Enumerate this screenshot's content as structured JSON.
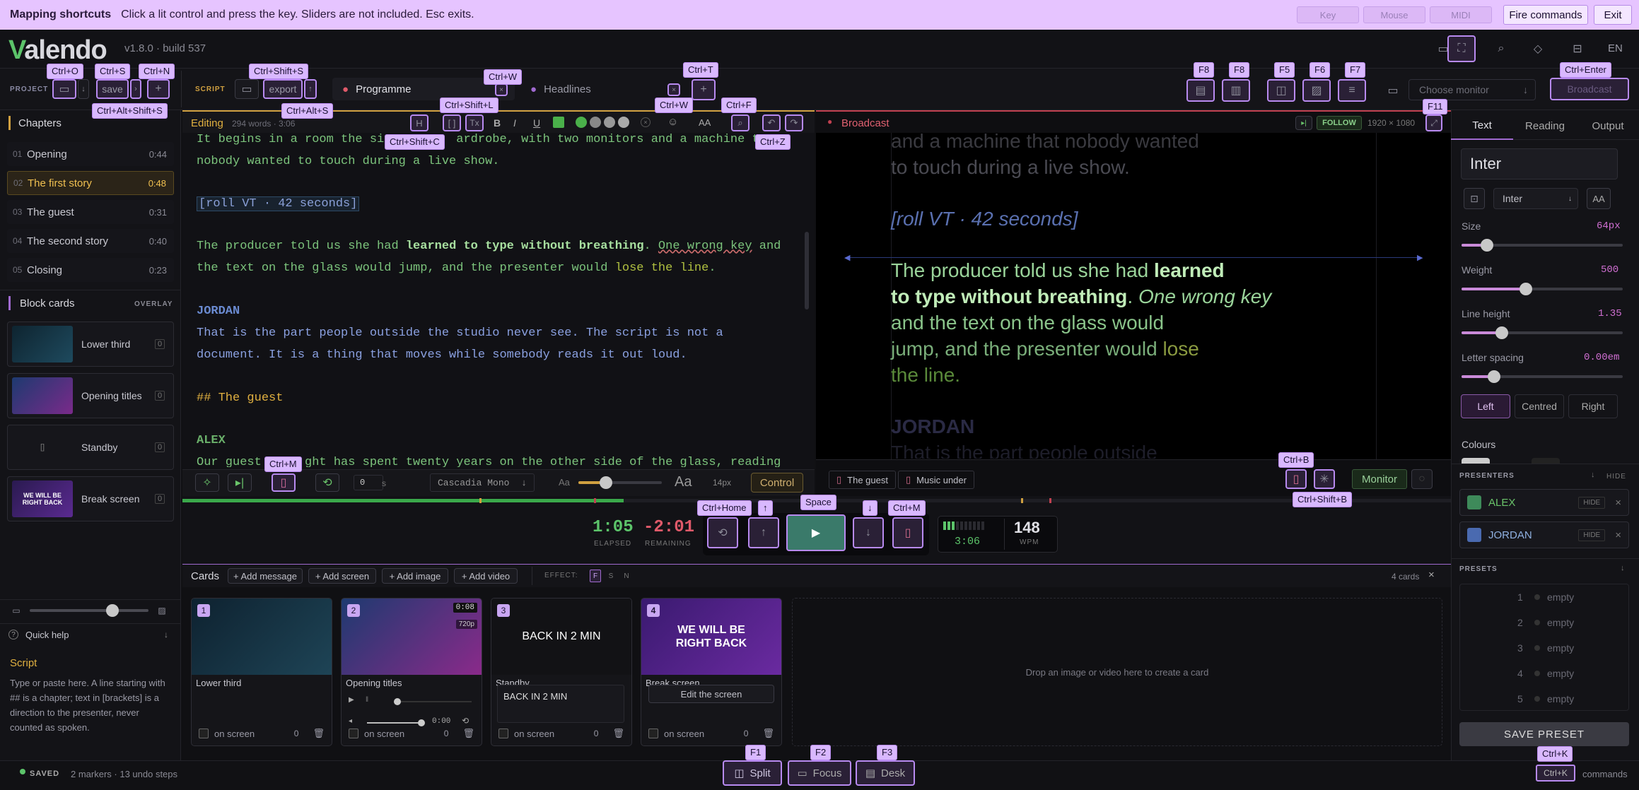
{
  "mapping": {
    "title": "Mapping shortcuts",
    "hint": "Click a lit control and press the key. Sliders are not included. Esc exits.",
    "key": "Key",
    "mouse": "Mouse",
    "midi": "MIDI",
    "fire": "Fire commands",
    "exit": "Exit"
  },
  "app": {
    "logo": "Valendo",
    "version": "v1.8.0 · build 537",
    "lang": "EN"
  },
  "toolbar": {
    "project": "PROJECT",
    "script": "SCRIPT",
    "save": "save",
    "export": "export",
    "tab1": "Programme",
    "tab2": "Headlines",
    "monitor_placeholder": "Choose monitor",
    "broadcast": "Broadcast"
  },
  "shortcuts": {
    "open": "Ctrl+O",
    "save": "Ctrl+S",
    "new": "Ctrl+N",
    "saveas": "Ctrl+Alt+Shift+S",
    "export": "Ctrl+Shift+S",
    "exportalt": "Ctrl+Alt+S",
    "closetab": "Ctrl+W",
    "newtab": "Ctrl+T",
    "f8a": "F8",
    "f8b": "F8",
    "f5": "F5",
    "f6": "F6",
    "f7": "F7",
    "broadcast": "Ctrl+Enter",
    "f11": "F11",
    "shl": "Ctrl+Shift+L",
    "shc": "Ctrl+Shift+C",
    "ctrlw2": "Ctrl+W",
    "ctrlf": "Ctrl+F",
    "ctrlz": "Ctrl+Z",
    "ctrlm1": "Ctrl+M",
    "home": "Ctrl+Home",
    "up": "↑",
    "space": "Space",
    "down": "↓",
    "ctrlm2": "Ctrl+M",
    "ctrlb": "Ctrl+B",
    "ctrlsb": "Ctrl+Shift+B",
    "f1": "F1",
    "f2": "F2",
    "f3": "F3",
    "ctrlk": "Ctrl+K"
  },
  "sidebar": {
    "chapters_title": "Chapters",
    "chapters": [
      {
        "n": "01",
        "name": "Opening",
        "time": "0:44"
      },
      {
        "n": "02",
        "name": "The first story",
        "time": "0:48"
      },
      {
        "n": "03",
        "name": "The guest",
        "time": "0:31"
      },
      {
        "n": "04",
        "name": "The second story",
        "time": "0:40"
      },
      {
        "n": "05",
        "name": "Closing",
        "time": "0:23"
      }
    ],
    "blocks_title": "Block cards",
    "overlay": "OVERLAY",
    "blocks": [
      {
        "name": "Lower third"
      },
      {
        "name": "Opening titles"
      },
      {
        "name": "Standby",
        "icon": "[]"
      },
      {
        "name": "Break screen",
        "thumb": "WE WILL BE RIGHT BACK"
      }
    ],
    "quick_help": "Quick help",
    "help_title": "Script",
    "help_body": [
      "Type or paste here. A line starting with",
      "## is a chapter; text in [brackets] is a",
      "direction to the presenter, never",
      "counted as spoken."
    ]
  },
  "editor": {
    "label": "Editing",
    "meta": "294 words · 3:06",
    "l1a": "It begins in a room the si",
    "l1b": "ardrobe, with two monitors and a machine t",
    "l2": "nobody wanted to touch during a live show.",
    "l3": "[roll VT · 42 seconds]",
    "l4a": "The producer told us she had ",
    "l4b": "learned to type without breathing",
    ". One wrong key": "",
    "l4c": ". ",
    "l4d": "One wrong key",
    "l4e": " and",
    "l5a": "the text on the glass would jump, and the presenter would ",
    "l5b": "lose the line",
    ".": "",
    "l5c": ".",
    "l6": "JORDAN",
    "l7": "That is the part people outside the studio never see. The script is not a",
    "l8": "document. It is a thing that moves while somebody reads it out loud.",
    "l9": "## The guest",
    "l10": "ALEX",
    "l11a": "Our guest",
    "l11b": "ght has spent twenty years on the other side of the glass, reading",
    "bottom": {
      "seconds": "0",
      "s": "s",
      "font": "Cascadia Mono",
      "aa_small": "Aa",
      "aa_big": "Aa",
      "size": "14px",
      "control": "Control"
    }
  },
  "preview": {
    "label": "Broadcast",
    "follow": "FOLLOW",
    "res": "1920 × 1080",
    "p1": "and a machine that nobody wanted",
    "p2": "to touch during a live show.",
    "p3": "[roll VT · 42 seconds]",
    "p4a": "The producer told us she had ",
    "p4b": "learned",
    "p5a": "to type without breathing",
    ". ": "",
    "p5b": ". ",
    "p5c": "One wrong key",
    "p6": "and the text on the glass would",
    "p7a": "jump, and the presenter would ",
    "p7b": "lose",
    "p8": "the line.",
    "p9": "JORDAN",
    "p10": "That is the part people outside",
    "marker1": "The guest",
    "marker2": "Music under",
    "monitor": "Monitor"
  },
  "transport": {
    "elapsed": "1:05",
    "elapsed_label": "ELAPSED",
    "remaining": "-2:01",
    "remaining_label": "REMAINING",
    "timer": "3:06",
    "wpm": "148",
    "wpm_label": "WPM"
  },
  "cards": {
    "title": "Cards",
    "add_message": "+ Add message",
    "add_screen": "+ Add screen",
    "add_image": "+ Add image",
    "add_video": "+ Add video",
    "effect": "EFFECT:",
    "fx": [
      "F",
      "S",
      "N"
    ],
    "count": "4 cards",
    "items": [
      {
        "n": "1",
        "name": "Lower third",
        "zero": "0",
        "on": "on screen"
      },
      {
        "n": "2",
        "name": "Opening titles",
        "zero": "0",
        "on": "on screen",
        "dur": "0:08",
        "res": "720p",
        "vtime": "0:00"
      },
      {
        "n": "3",
        "name": "Standby",
        "zero": "0",
        "on": "on screen",
        "big": "BACK IN 2 MIN",
        "field": "BACK IN 2 MIN"
      },
      {
        "n": "4",
        "name": "Break screen",
        "zero": "0",
        "on": "on screen",
        "big": "WE WILL BE RIGHT BACK",
        "edit": "Edit the screen"
      }
    ],
    "drop": "Drop an image or video here to create a card"
  },
  "inspector": {
    "tabs": [
      "Text",
      "Reading",
      "Output"
    ],
    "font_name": "Inter",
    "font_select": "Inter",
    "aa": "AA",
    "size_label": "Size",
    "size": "64px",
    "size_f": 0.16,
    "weight_label": "Weight",
    "weight": "500",
    "weight_f": 0.4,
    "lh_label": "Line height",
    "lh": "1.35",
    "lh_f": 0.25,
    "ls_label": "Letter spacing",
    "ls": "0.00em",
    "ls_f": 0.2,
    "align": [
      "Left",
      "Centred",
      "Right"
    ],
    "colours": "Colours",
    "presenters_title": "PRESENTERS",
    "hide": "HIDE",
    "presenters": [
      {
        "name": "ALEX",
        "color": "#3e8a5a"
      },
      {
        "name": "JORDAN",
        "color": "#4a6ab0"
      }
    ],
    "presets_title": "PRESETS",
    "presets": [
      {
        "n": "1",
        "t": "empty"
      },
      {
        "n": "2",
        "t": "empty"
      },
      {
        "n": "3",
        "t": "empty"
      },
      {
        "n": "4",
        "t": "empty"
      },
      {
        "n": "5",
        "t": "empty"
      }
    ],
    "save_preset": "SAVE PRESET"
  },
  "status": {
    "saved": "SAVED",
    "info": "2 markers · 13 undo steps",
    "split": "Split",
    "focus": "Focus",
    "desk": "Desk",
    "cmd_key": "Ctrl+K",
    "commands": "commands"
  }
}
